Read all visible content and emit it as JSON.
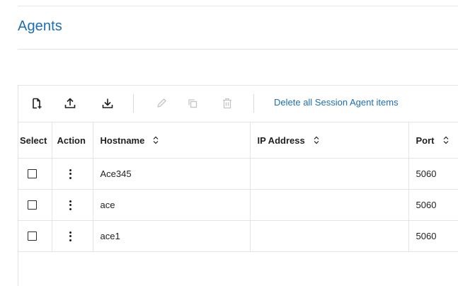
{
  "page": {
    "title": "Agents"
  },
  "toolbar": {
    "buttons": [
      {
        "icon": "new-file-icon",
        "enabled": true
      },
      {
        "icon": "upload-icon",
        "enabled": true
      },
      {
        "icon": "download-icon",
        "enabled": true
      },
      {
        "icon": "edit-icon",
        "enabled": false
      },
      {
        "icon": "copy-icon",
        "enabled": false
      },
      {
        "icon": "delete-icon",
        "enabled": false
      }
    ],
    "delete_all_label": "Delete all Session Agent items"
  },
  "table": {
    "columns": {
      "select": "Select",
      "action": "Action",
      "hostname": "Hostname",
      "ip_address": "IP Address",
      "port": "Port"
    },
    "rows": [
      {
        "hostname": "Ace345",
        "ip_address": "",
        "port": "5060",
        "selected": false
      },
      {
        "hostname": "ace",
        "ip_address": "",
        "port": "5060",
        "selected": false
      },
      {
        "hostname": "ace1",
        "ip_address": "",
        "port": "5060",
        "selected": false
      }
    ]
  },
  "colors": {
    "accent": "#1c6eb5",
    "icon_enabled": "#1f1f1f",
    "icon_disabled": "#c4c4c4",
    "border": "#e4e4e4"
  }
}
